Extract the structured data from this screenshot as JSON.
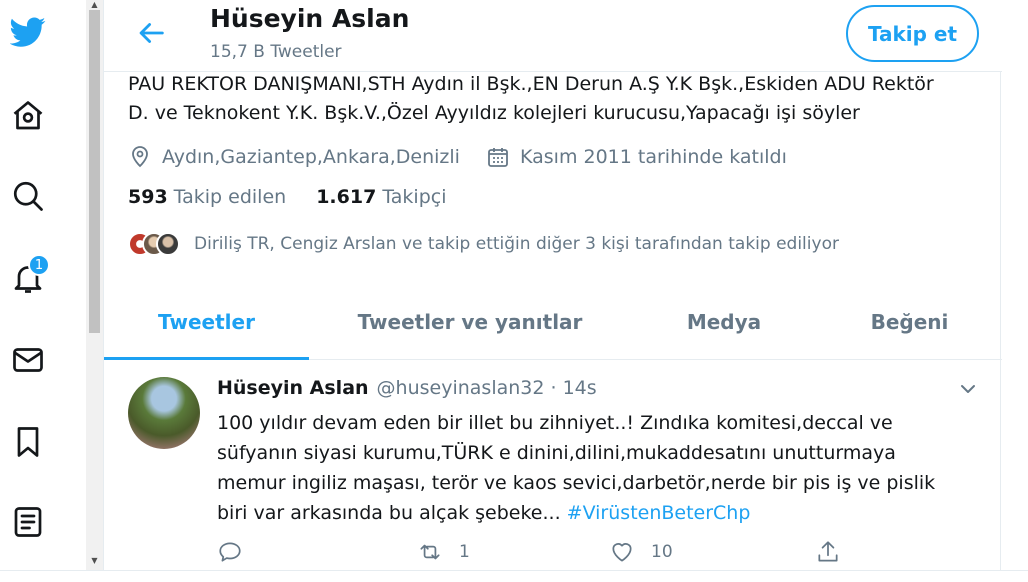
{
  "nav": {
    "notification_count": "1",
    "icons": [
      "twitter-icon",
      "home-icon",
      "explore-icon",
      "notifications-icon",
      "messages-icon",
      "bookmarks-icon",
      "lists-icon"
    ]
  },
  "header": {
    "name": "Hüseyin Aslan",
    "tweet_count": "15,7 B Tweetler",
    "follow_label": "Takip et"
  },
  "profile": {
    "bio_line1": "PAU REKTOR DANIŞMANI,STH Aydın il Bşk.,EN Derun A.Ş Y.K Bşk.,Eskiden ADU Rektör",
    "bio_line2": "D. ve Teknokent Y.K. Bşk.V.,Özel Ayyıldız kolejleri kurucusu,Yapacağı işi söyler",
    "location": "Aydın,Gaziantep,Ankara,Denizli",
    "joined": "Kasım 2011 tarihinde katıldı",
    "following_count": "593",
    "following_label": "Takip edilen",
    "followers_count": "1.617",
    "followers_label": "Takipçi",
    "followed_by": "Diriliş TR, Cengiz Arslan ve takip ettiğin diğer 3 kişi tarafından takip ediliyor"
  },
  "tabs": [
    {
      "label": "Tweetler",
      "active": true
    },
    {
      "label": "Tweetler ve yanıtlar",
      "active": false
    },
    {
      "label": "Medya",
      "active": false
    },
    {
      "label": "Beğeni",
      "active": false
    }
  ],
  "tweet": {
    "name": "Hüseyin Aslan",
    "handle": "@huseyinaslan32 · 14s",
    "line1": "100 yıldır devam eden bir illet bu zihniyet..! Zındıka komitesi,deccal ve",
    "line2": "süfyanın siyasi kurumu,TÜRK e dinini,dilini,mukaddesatını unutturmaya",
    "line3": "memur ingiliz maşası, terör ve kaos sevici,darbetör,nerde bir pis iş ve pislik",
    "line4": "biri var arkasında bu alçak şebeke...",
    "hashtag": "#VirüstenBeterChp",
    "retweets": "1",
    "likes": "10"
  },
  "colors": {
    "accent": "#1da1f2",
    "muted": "#657786",
    "text": "#14171a"
  }
}
